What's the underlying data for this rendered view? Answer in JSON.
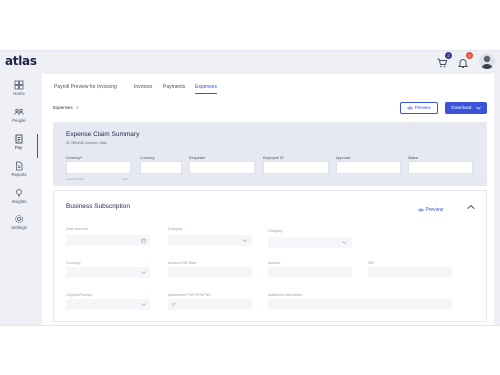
{
  "app": {
    "logo_small": "",
    "logo": "atlas"
  },
  "header": {
    "cart_count": "2",
    "notification_count": "0",
    "colors": {
      "cart_badge": "#2d3a8c",
      "notif_badge": "#e2523a"
    }
  },
  "sidebar": {
    "items": [
      {
        "label": "Home",
        "icon": "home-icon"
      },
      {
        "label": "People",
        "icon": "people-icon"
      },
      {
        "label": "Pay",
        "icon": "pay-icon"
      },
      {
        "label": "Reports",
        "icon": "reports-icon"
      },
      {
        "label": "Insights",
        "icon": "insights-icon"
      },
      {
        "label": "Settings",
        "icon": "settings-icon"
      }
    ],
    "active": "Pay"
  },
  "tabs": [
    {
      "label": "Payroll Preview for Invoicing"
    },
    {
      "label": "Invoices"
    },
    {
      "label": "Payments"
    },
    {
      "label": "Expenses"
    }
  ],
  "active_tab": "Expenses",
  "breadcrumb": {
    "label": "Expenses",
    "sep": ">"
  },
  "actions": {
    "preview": "Preview",
    "download": "Download"
  },
  "summary": {
    "title": "Expense Claim Summary",
    "subtitle": "ID: 0800848    Customer: Atlas",
    "fields": [
      {
        "label": "Currency*"
      },
      {
        "label": "Currency"
      },
      {
        "label": "Requester"
      },
      {
        "label": "Employee ID"
      },
      {
        "label": "Approver"
      },
      {
        "label": "Status"
      }
    ],
    "hint_left": "Local FX Rate",
    "hint_right": "0.00"
  },
  "subscription": {
    "title": "Business Subscription",
    "preview": "Preview",
    "fields": [
      {
        "label": "Date Incurred"
      },
      {
        "label": "Category"
      },
      {
        "label": "Category"
      },
      {
        "label": "Currency"
      },
      {
        "label": "Amount INR Rate"
      },
      {
        "label": "Amount"
      },
      {
        "label": "VAT"
      },
      {
        "label": "Original Receipt"
      },
      {
        "label": "Attachment PDF/JPG/PNG"
      },
      {
        "label": "Additional information"
      }
    ]
  }
}
